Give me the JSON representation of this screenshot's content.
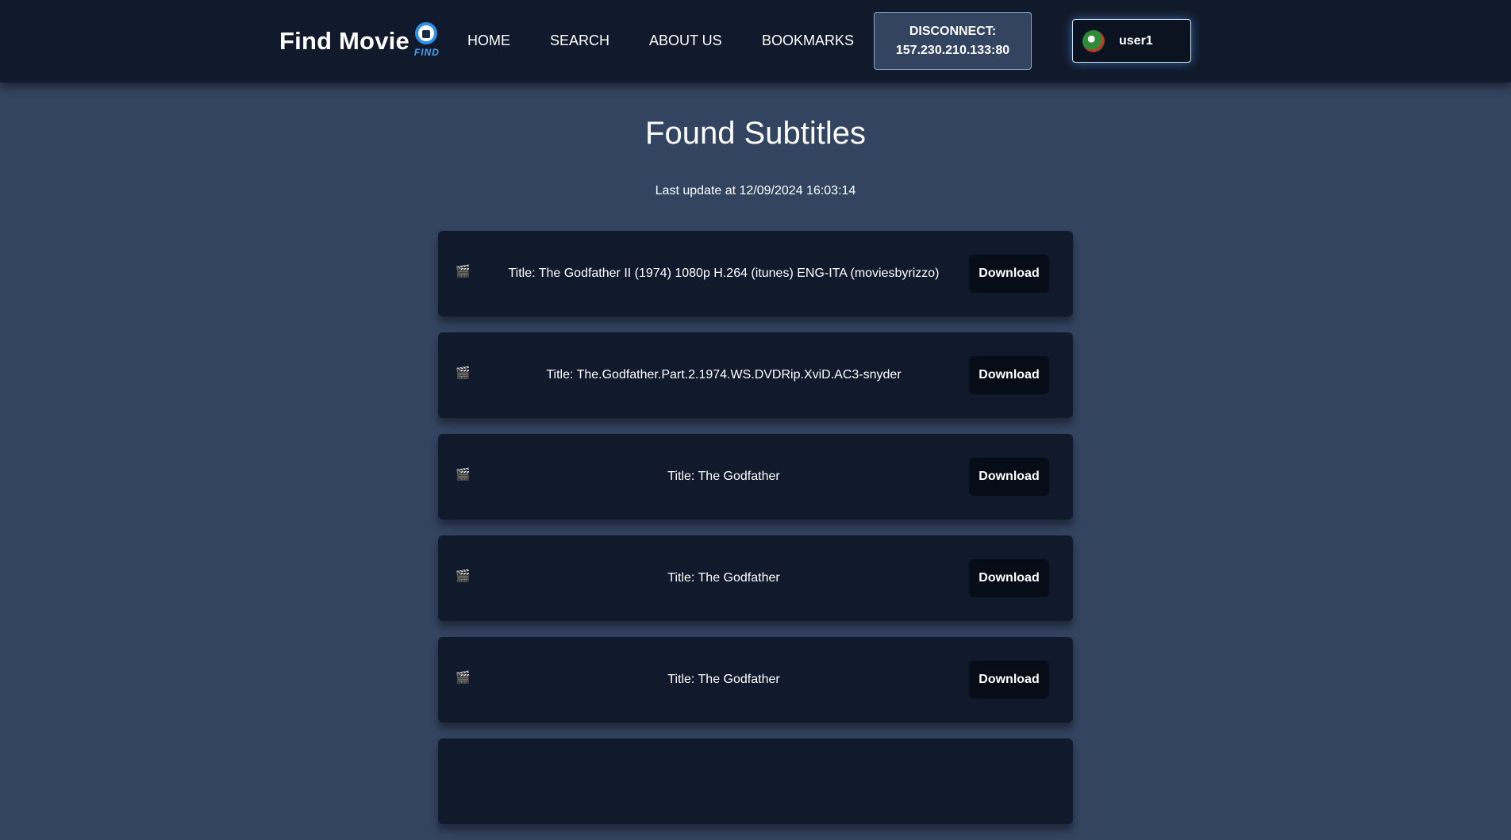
{
  "nav": {
    "brand": "Find Movie",
    "logo_text": "FIND",
    "links": [
      "HOME",
      "SEARCH",
      "ABOUT US",
      "BOOKMARKS"
    ],
    "disconnect_label": "DISCONNECT:",
    "disconnect_address": "157.230.210.133:80",
    "user": "user1"
  },
  "main": {
    "title": "Found Subtitles",
    "last_update": "Last update at 12/09/2024 16:03:14",
    "download_label": "Download",
    "item_icon": "clapperboard-icon",
    "items": [
      {
        "title": "Title: The Godfather II (1974) 1080p H.264 (itunes) ENG-ITA (moviesbyrizzo)"
      },
      {
        "title": "Title: The.Godfather.Part.2.1974.WS.DVDRip.XviD.AC3-snyder"
      },
      {
        "title": "Title: The Godfather"
      },
      {
        "title": "Title: The Godfather"
      },
      {
        "title": "Title: The Godfather"
      },
      {
        "title": ""
      }
    ]
  },
  "colors": {
    "page_bg": "#334460",
    "nav_bg": "#111a2c",
    "card_bg": "#111a2c",
    "button_bg": "#070d17",
    "accent": "#2f8fe6"
  }
}
